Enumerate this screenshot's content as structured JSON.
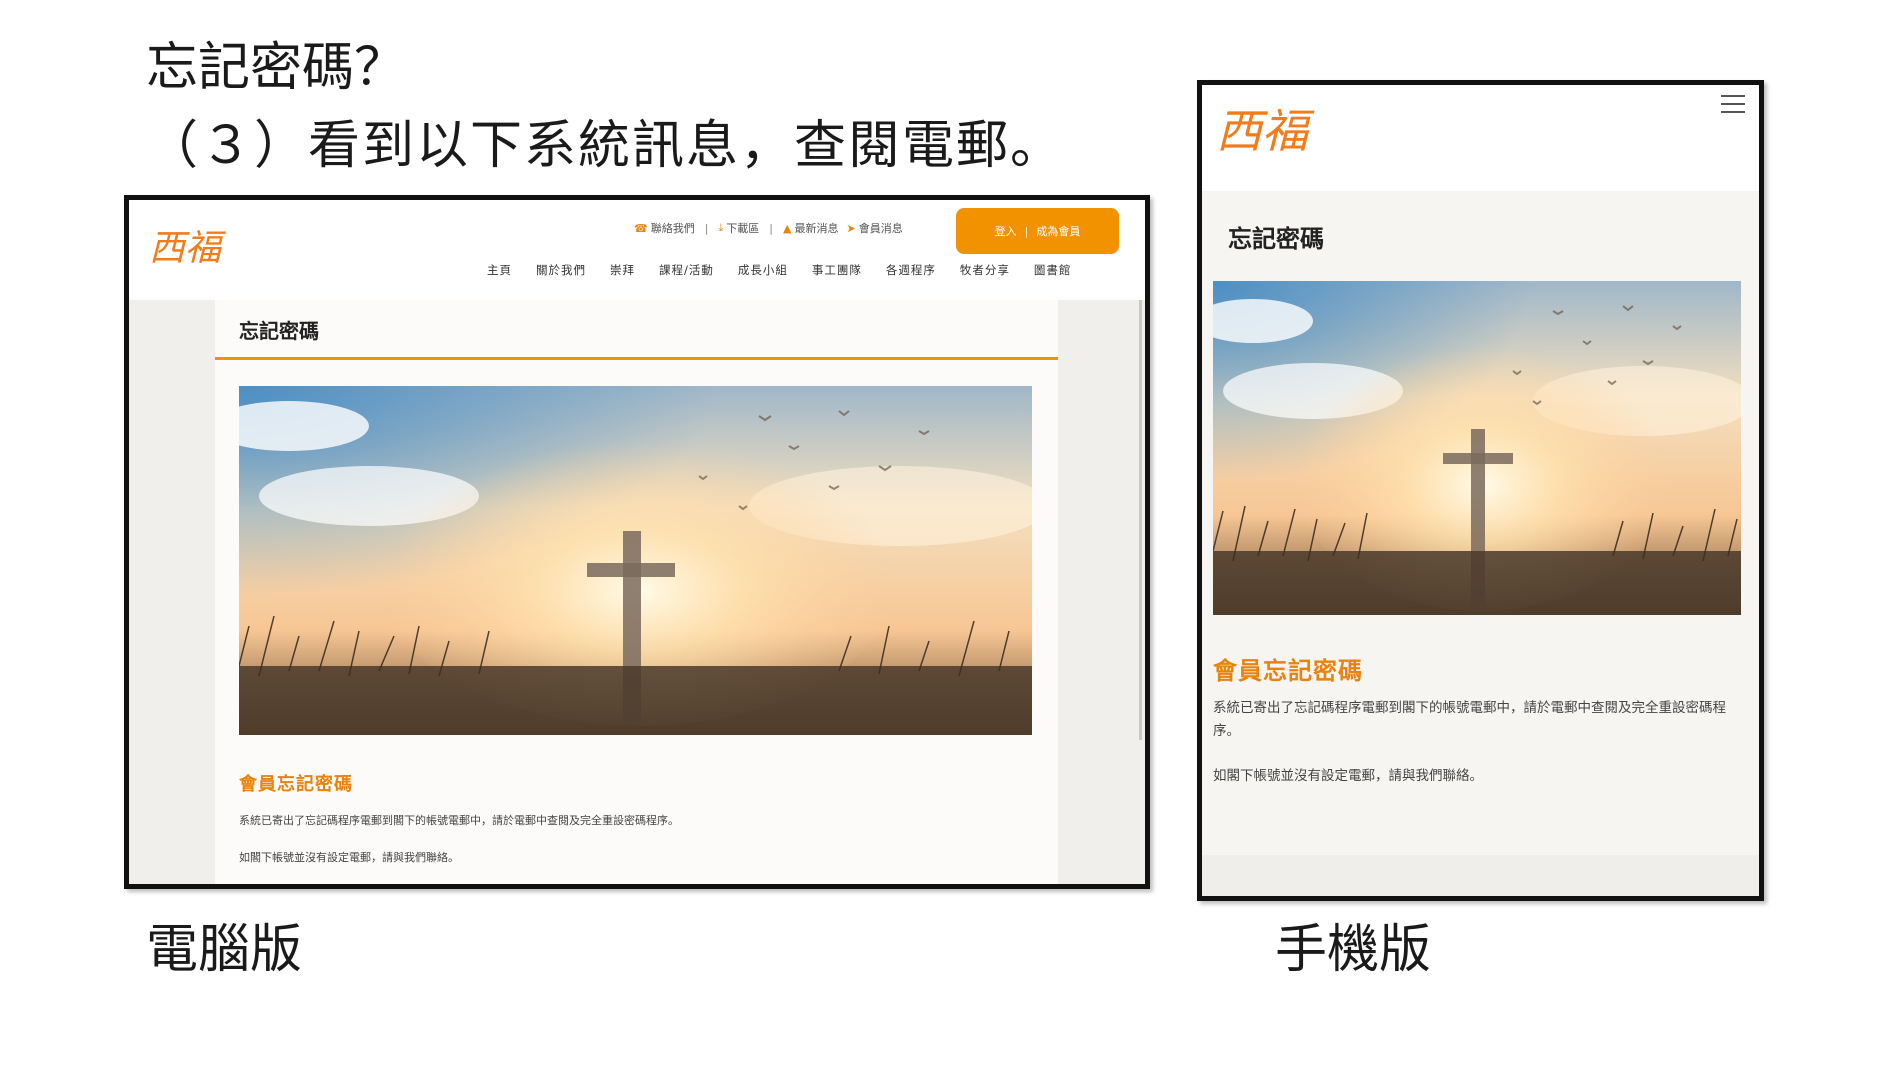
{
  "slide": {
    "title": "忘記密碼？",
    "subtitle": "（３）看到以下系統訊息，查閱電郵。",
    "caption_desktop": "電腦版",
    "caption_mobile": "手機版"
  },
  "site": {
    "logo_text": "西福",
    "topbar": [
      {
        "icon": "phone-icon",
        "label": "聯絡我們"
      },
      {
        "icon": "download-icon",
        "label": "下載區"
      },
      {
        "icon": "bell-icon",
        "label": "最新消息"
      },
      {
        "icon": "send-icon",
        "label": "會員消息"
      }
    ],
    "login_label": "登入",
    "register_label": "成為會員",
    "nav": [
      "主頁",
      "關於我們",
      "崇拜",
      "課程/活動",
      "成長小組",
      "事工團隊",
      "各週程序",
      "牧者分享",
      "圖書館"
    ]
  },
  "page": {
    "title": "忘記密碼",
    "heading": "會員忘記密碼",
    "message1": "系統已寄出了忘記碼程序電郵到閣下的帳號電郵中，請於電郵中查閱及完全重設密碼程序。",
    "message2": "如閣下帳號並沒有設定電郵，請與我們聯絡。"
  },
  "colors": {
    "accent": "#f39200",
    "heading": "#e8830f"
  }
}
